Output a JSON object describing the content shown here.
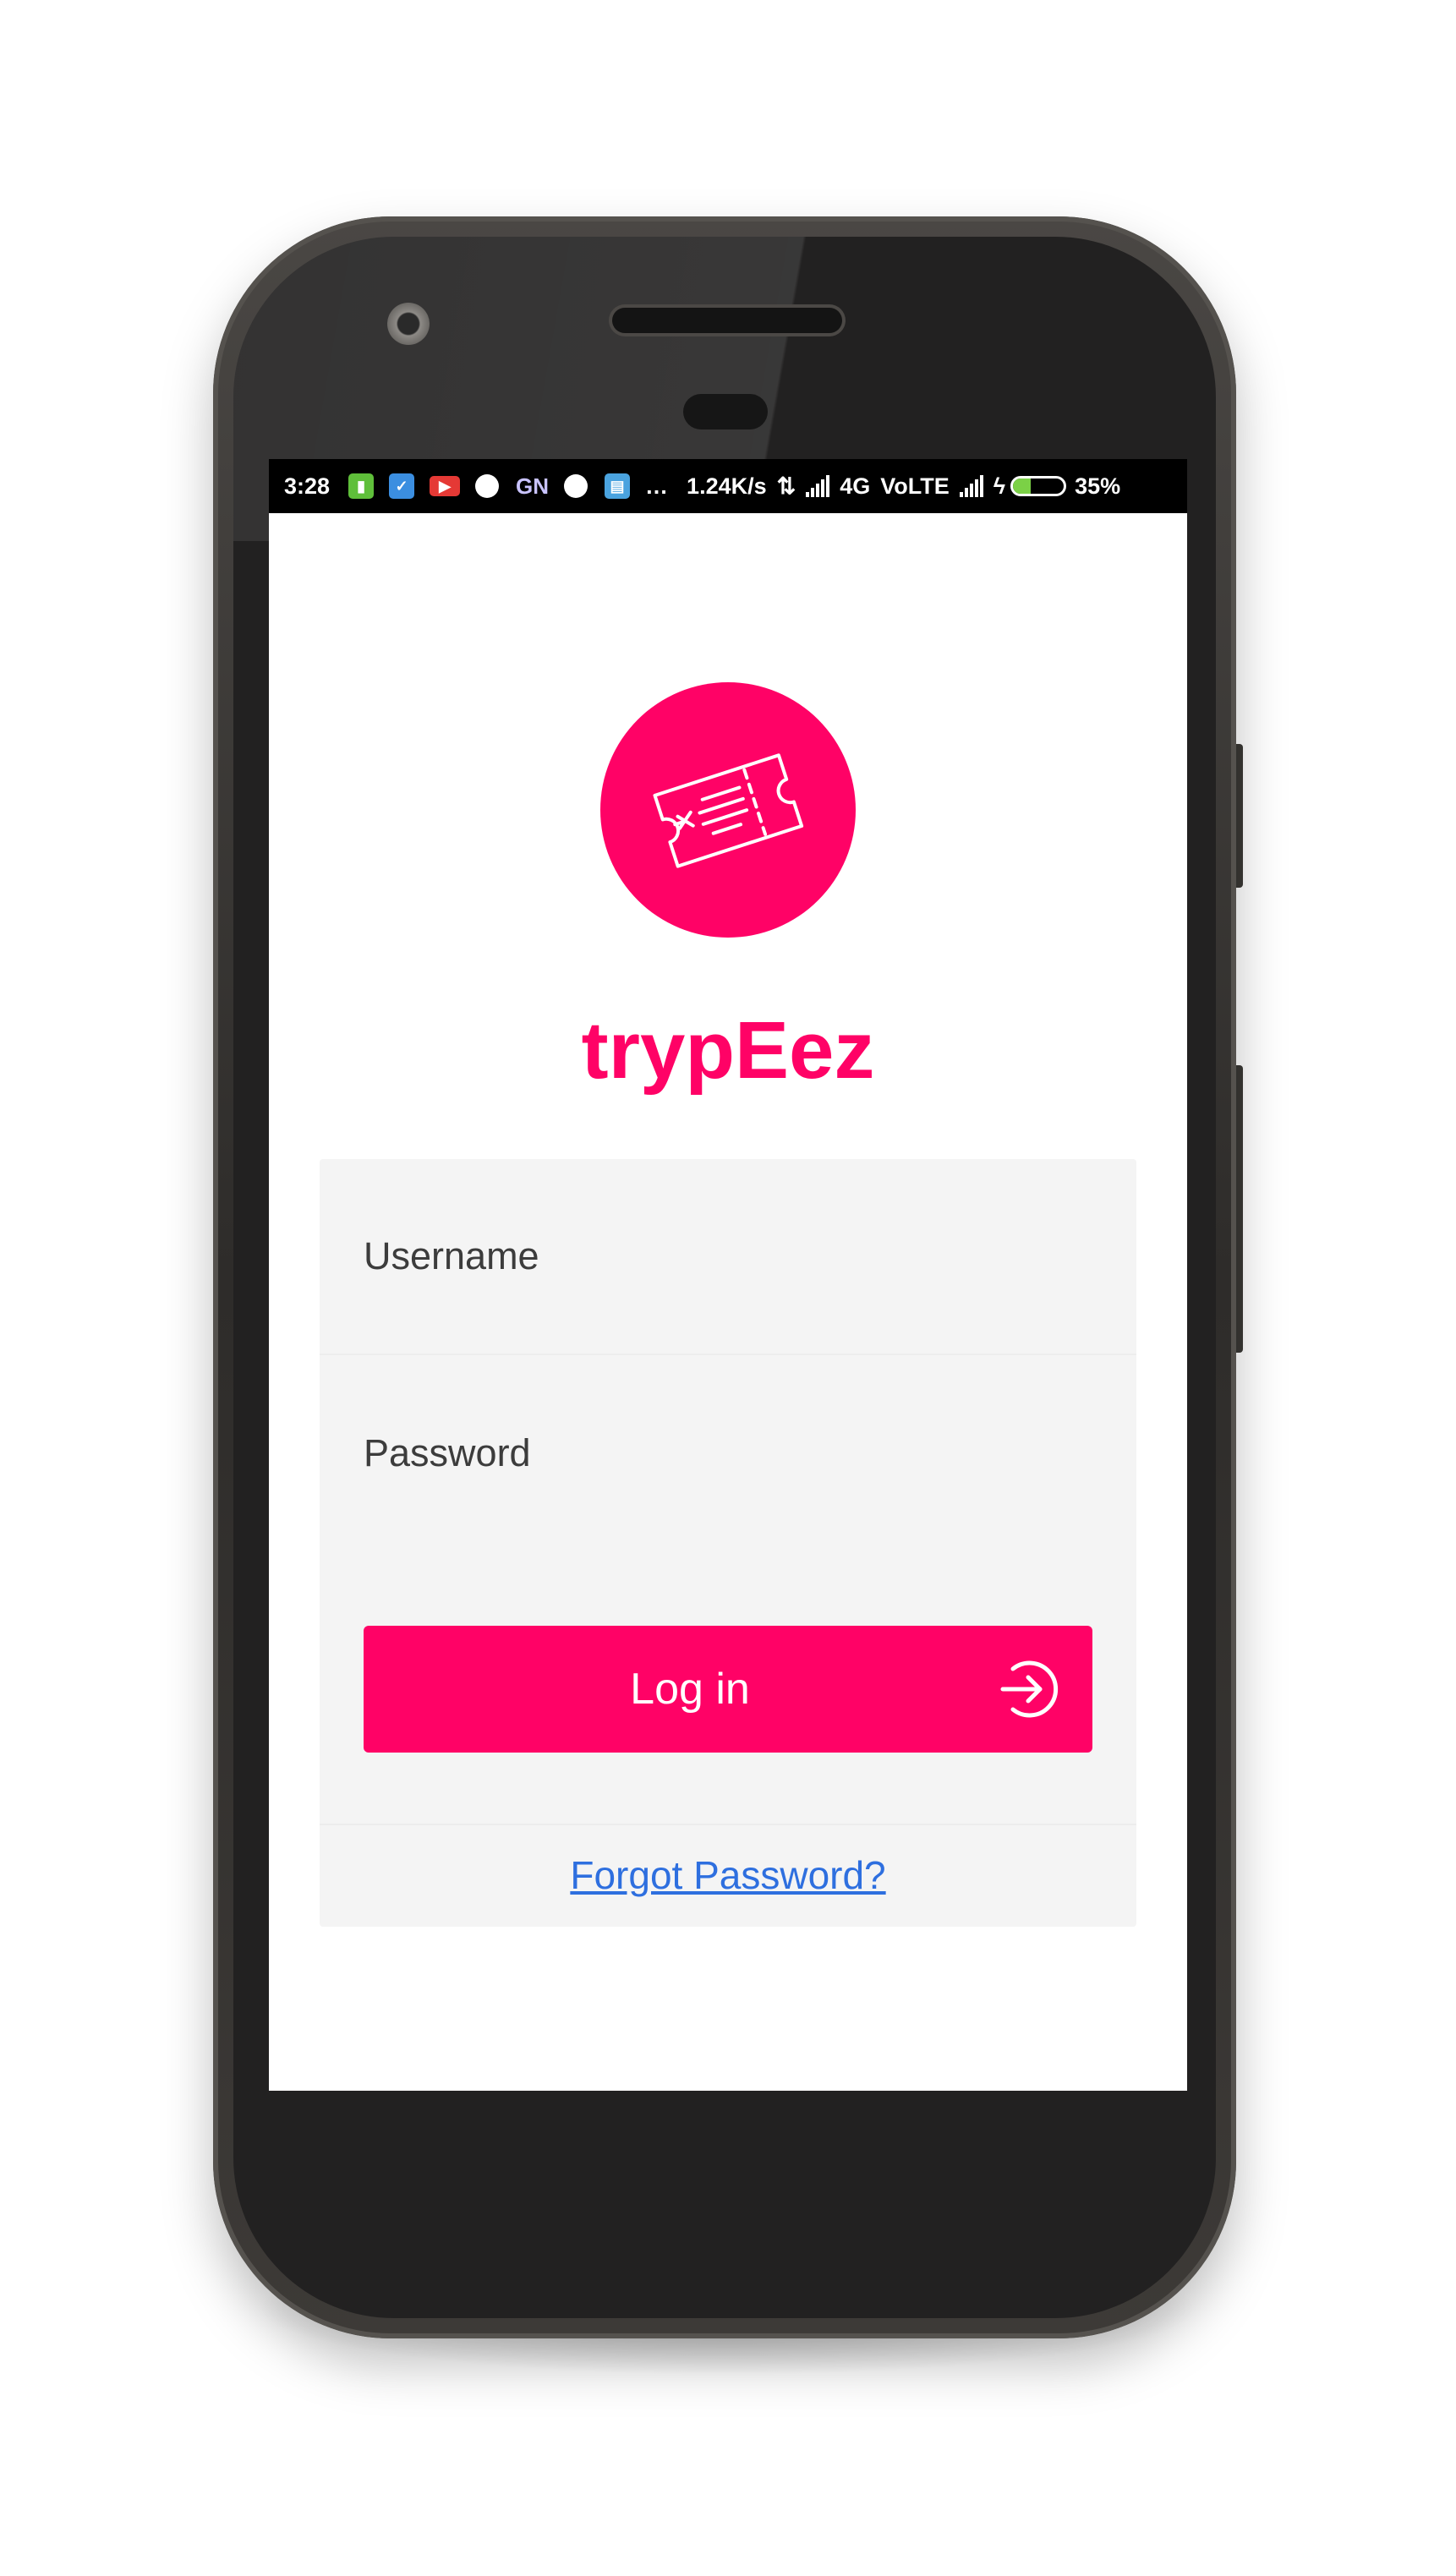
{
  "status_bar": {
    "time": "3:28",
    "overflow": "…",
    "speed": "1.24K/s",
    "network": "4G",
    "volte": "VoLTE",
    "gn_label": "GN",
    "battery_percent": "35%",
    "battery_level": 0.35
  },
  "app": {
    "name": "trypEez",
    "brand_color": "#ff0266",
    "logo_icon": "ticket-icon"
  },
  "login_form": {
    "username_placeholder": "Username",
    "password_placeholder": "Password",
    "login_label": "Log in",
    "login_icon": "sign-in-arrow-icon",
    "forgot_label": "Forgot Password?"
  }
}
